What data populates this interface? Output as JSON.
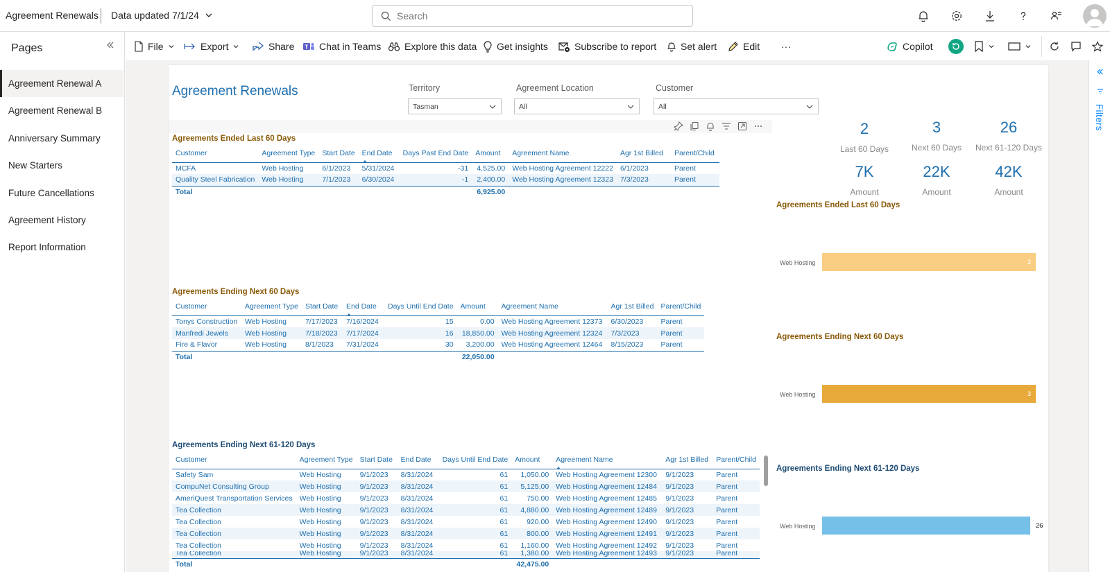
{
  "app": {
    "title": "Agreement Renewals",
    "data_updated": "Data updated 7/1/24",
    "search_placeholder": "Search"
  },
  "pages": {
    "title": "Pages",
    "items": [
      {
        "label": "Agreement Renewal A",
        "active": true
      },
      {
        "label": "Agreement Renewal B"
      },
      {
        "label": "Anniversary Summary"
      },
      {
        "label": "New Starters"
      },
      {
        "label": "Future Cancellations"
      },
      {
        "label": "Agreement History"
      },
      {
        "label": "Report Information"
      }
    ]
  },
  "toolbar": {
    "file": "File",
    "export": "Export",
    "share": "Share",
    "chat": "Chat in Teams",
    "explore": "Explore this data",
    "insights": "Get insights",
    "subscribe": "Subscribe to report",
    "alert": "Set alert",
    "edit": "Edit",
    "more": "···",
    "copilot": "Copilot"
  },
  "filters_pane": {
    "label": "Filters"
  },
  "report": {
    "title": "Agreement Renewals",
    "slicers": [
      {
        "label": "Territory",
        "value": "Tasman"
      },
      {
        "label": "Agreement Location",
        "value": "All"
      },
      {
        "label": "Customer",
        "value": "All"
      }
    ],
    "kpis": [
      {
        "value": "2",
        "label": "Last 60 Days"
      },
      {
        "value": "3",
        "label": "Next 60 Days"
      },
      {
        "value": "26",
        "label": "Next 61-120 Days"
      },
      {
        "value": "7K",
        "label": "Amount"
      },
      {
        "value": "22K",
        "label": "Amount"
      },
      {
        "value": "42K",
        "label": "Amount"
      }
    ],
    "table1": {
      "title": "Agreements Ended Last 60 Days",
      "columns": [
        "Customer",
        "Agreement Type",
        "Start Date",
        "End Date",
        "Days Past End Date",
        "Amount",
        "Agreement Name",
        "Agr 1st Billed",
        "Parent/Child"
      ],
      "rows": [
        [
          "MCFA",
          "Web Hosting",
          "6/1/2023",
          "5/31/2024",
          "-31",
          "4,525.00",
          "Web Hosting Agreement 12222",
          "6/1/2023",
          "Parent"
        ],
        [
          "Quality Steel Fabrication",
          "Web Hosting",
          "7/1/2023",
          "6/30/2024",
          "-1",
          "2,400.00",
          "Web Hosting Agreement 12323",
          "7/3/2023",
          "Parent"
        ]
      ],
      "total_label": "Total",
      "total_amount": "6,925.00"
    },
    "table2": {
      "title": "Agreements Ending Next 60 Days",
      "columns": [
        "Customer",
        "Agreement Type",
        "Start Date",
        "End Date",
        "Days Until End Date",
        "Amount",
        "Agreement Name",
        "Agr 1st Billed",
        "Parent/Child"
      ],
      "rows": [
        [
          "Tonys Construction",
          "Web Hosting",
          "7/17/2023",
          "7/16/2024",
          "15",
          "0.00",
          "Web Hosting Agreement 12373",
          "6/30/2023",
          "Parent"
        ],
        [
          "Manfredi Jewels",
          "Web Hosting",
          "7/18/2023",
          "7/17/2024",
          "16",
          "18,850.00",
          "Web Hosting Agreement 12324",
          "7/3/2023",
          "Parent"
        ],
        [
          "Fire & Flavor",
          "Web Hosting",
          "8/1/2023",
          "7/31/2024",
          "30",
          "3,200.00",
          "Web Hosting Agreement 12464",
          "8/15/2023",
          "Parent"
        ]
      ],
      "total_label": "Total",
      "total_amount": "22,050.00"
    },
    "table3": {
      "title": "Agreements Ending Next 61-120 Days",
      "columns": [
        "Customer",
        "Agreement Type",
        "Start Date",
        "End Date",
        "Days Until End Date",
        "Amount",
        "Agreement Name",
        "Agr 1st Billed",
        "Parent/Child"
      ],
      "rows": [
        [
          "Safety Sam",
          "Web Hosting",
          "9/1/2023",
          "8/31/2024",
          "61",
          "1,050.00",
          "Web Hosting Agreement 12300",
          "9/1/2023",
          "Parent"
        ],
        [
          "CompuNet Consulting Group",
          "Web Hosting",
          "9/1/2023",
          "8/31/2024",
          "61",
          "5,125.00",
          "Web Hosting Agreement 12484",
          "9/1/2023",
          "Parent"
        ],
        [
          "AmeriQuest Transportation Services",
          "Web Hosting",
          "9/1/2023",
          "8/31/2024",
          "61",
          "750.00",
          "Web Hosting Agreement 12485",
          "9/1/2023",
          "Parent"
        ],
        [
          "Tea Collection",
          "Web Hosting",
          "9/1/2023",
          "8/31/2024",
          "61",
          "4,880.00",
          "Web Hosting Agreement 12489",
          "9/1/2023",
          "Parent"
        ],
        [
          "Tea Collection",
          "Web Hosting",
          "9/1/2023",
          "8/31/2024",
          "61",
          "920.00",
          "Web Hosting Agreement 12490",
          "9/1/2023",
          "Parent"
        ],
        [
          "Tea Collection",
          "Web Hosting",
          "9/1/2023",
          "8/31/2024",
          "61",
          "800.00",
          "Web Hosting Agreement 12491",
          "9/1/2023",
          "Parent"
        ],
        [
          "Tea Collection",
          "Web Hosting",
          "9/1/2023",
          "8/31/2024",
          "61",
          "1,160.00",
          "Web Hosting Agreement 12492",
          "9/1/2023",
          "Parent"
        ],
        [
          "Tea Collection",
          "Web Hosting",
          "9/1/2023",
          "8/31/2024",
          "61",
          "1,380.00",
          "Web Hosting Agreement 12493",
          "9/1/2023",
          "Parent"
        ]
      ],
      "total_label": "Total",
      "total_amount": "42,475.00"
    },
    "bar_charts": [
      {
        "title": "Agreements Ended Last 60 Days",
        "category": "Web Hosting",
        "value": 2,
        "color": "#f9cd82"
      },
      {
        "title": "Agreements Ending Next 60 Days",
        "category": "Web Hosting",
        "value": 3,
        "color": "#e8a93b"
      },
      {
        "title": "Agreements Ending Next 61-120 Days",
        "category": "Web Hosting",
        "value": 26,
        "color": "#74c0e9"
      }
    ]
  },
  "colors": {
    "accent": "#1e6fae",
    "brown_title": "#8a5a08",
    "navy_title": "#1d4b73",
    "filters": "#118dff",
    "copilot_badge": "#11a683"
  }
}
